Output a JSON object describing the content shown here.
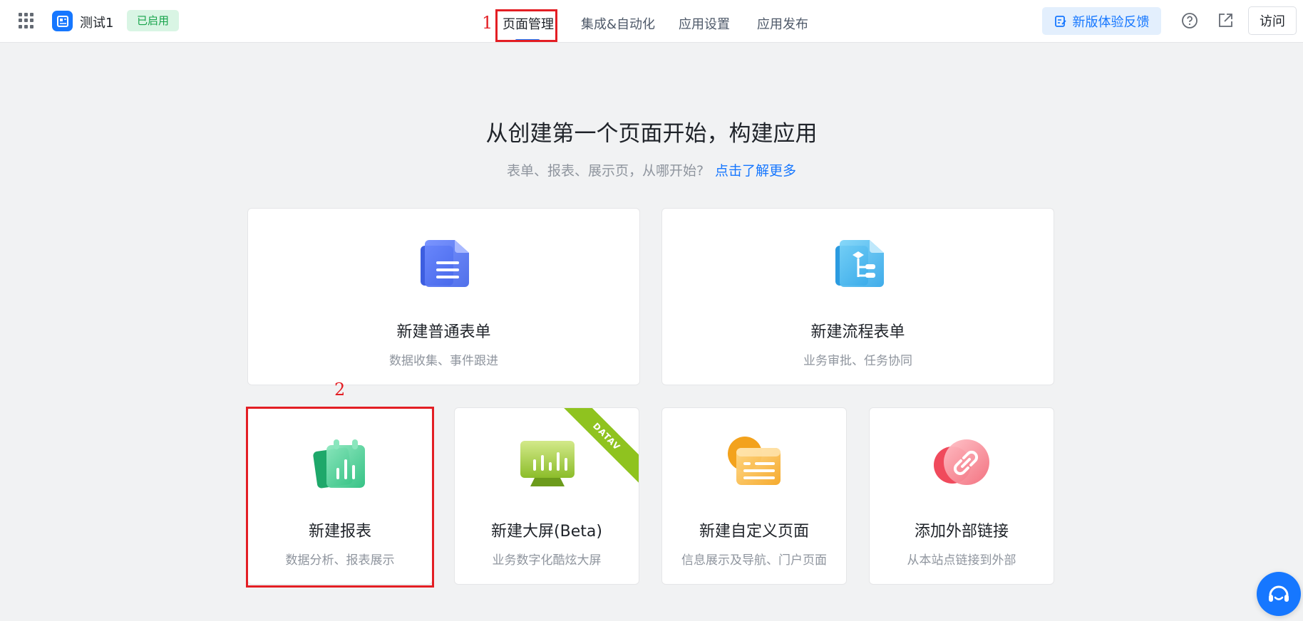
{
  "header": {
    "app_name": "测试1",
    "status": "已启用",
    "nav": [
      {
        "label": "页面管理",
        "active": true
      },
      {
        "label": "集成&自动化",
        "active": false
      },
      {
        "label": "应用设置",
        "active": false
      },
      {
        "label": "应用发布",
        "active": false
      }
    ],
    "feedback_label": "新版体验反馈",
    "visit_label": "访问"
  },
  "annotations": {
    "one": "1",
    "two": "2"
  },
  "hero": {
    "title": "从创建第一个页面开始，构建应用",
    "subtitle": "表单、报表、展示页，从哪开始?",
    "link": "点击了解更多"
  },
  "cards": [
    {
      "title": "新建普通表单",
      "desc": "数据收集、事件跟进",
      "icon": "form-icon"
    },
    {
      "title": "新建流程表单",
      "desc": "业务审批、任务协同",
      "icon": "process-form-icon"
    },
    {
      "title": "新建报表",
      "desc": "数据分析、报表展示",
      "icon": "report-icon"
    },
    {
      "title": "新建大屏(Beta)",
      "desc": "业务数字化酷炫大屏",
      "icon": "dashboard-screen-icon",
      "ribbon": "DATAV"
    },
    {
      "title": "新建自定义页面",
      "desc": "信息展示及导航、门户页面",
      "icon": "custom-page-icon"
    },
    {
      "title": "添加外部链接",
      "desc": "从本站点链接到外部",
      "icon": "link-icon"
    }
  ],
  "colors": {
    "primary": "#1677ff",
    "status_green": "#16a34a",
    "annotation_red": "#e31e24"
  }
}
